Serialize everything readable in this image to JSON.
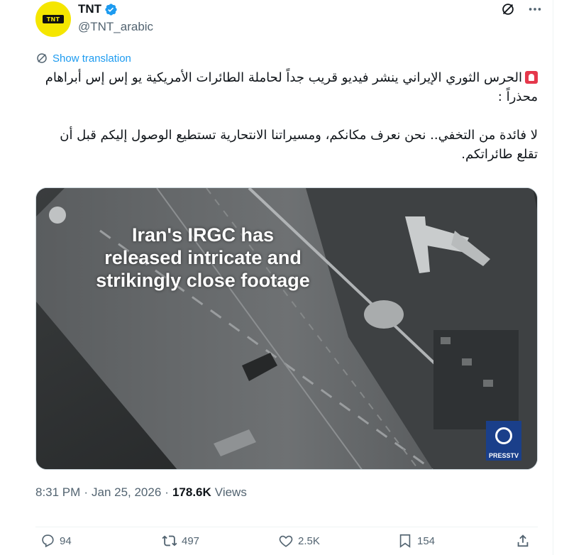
{
  "author": {
    "display_name": "TNT",
    "handle": "@TNT_arabic",
    "avatar_text": "TNT",
    "verified": true
  },
  "show_translation": "Show translation",
  "tweet": {
    "line1": "الحرس الثوري الإيراني ينشر فيديو قريب جداً لحاملة الطائرات الأمريكية يو إس إس أبراهام محذراً :",
    "line2": "لا فائدة من التخفي.. نحن نعرف مكانكم، ومسيراتنا الانتحارية تستطيع الوصول إليكم قبل أن تقلع طائراتكم."
  },
  "media": {
    "caption_line1": "Iran's IRGC has",
    "caption_line2": "released intricate and",
    "caption_line3": "strikingly close footage",
    "watermark": "PRESSTV"
  },
  "meta": {
    "time": "8:31 PM",
    "separator": "·",
    "date": "Jan 25, 2026",
    "views_count": "178.6K",
    "views_label": "Views"
  },
  "actions": {
    "replies": "94",
    "reposts": "497",
    "likes": "2.5K",
    "bookmarks": "154"
  },
  "colors": {
    "accent": "#1d9bf0",
    "secondary_text": "#536471",
    "avatar_bg": "#f5e600"
  }
}
